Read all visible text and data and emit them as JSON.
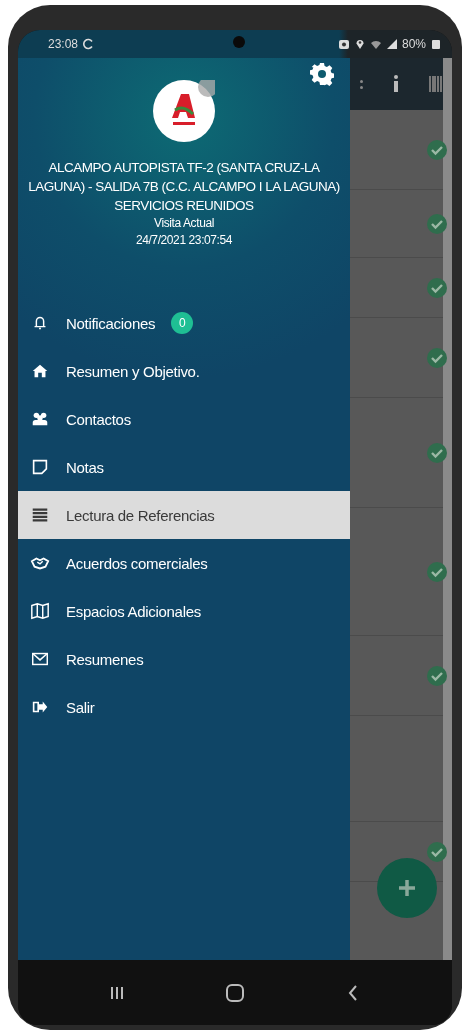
{
  "status_bar": {
    "time": "23:08",
    "battery": "80%"
  },
  "drawer": {
    "header": {
      "store_name": "ALCAMPO AUTOPISTA TF-2 (SANTA CRUZ-LA LAGUNA) - SALIDA 7B (C.C. ALCAMPO I LA LAGUNA)",
      "group": "SERVICIOS REUNIDOS",
      "visit_label": "Visita Actual",
      "visit_time": "24/7/2021 23:07:54"
    },
    "items": [
      {
        "kind": "bell",
        "label": "Notificaciones",
        "badge": "0",
        "selected": false
      },
      {
        "kind": "home",
        "label": "Resumen y Objetivo.",
        "selected": false
      },
      {
        "kind": "people",
        "label": "Contactos",
        "selected": false
      },
      {
        "kind": "note",
        "label": "Notas",
        "selected": false
      },
      {
        "kind": "list",
        "label": "Lectura de Referencias",
        "selected": true
      },
      {
        "kind": "handshake",
        "label": "Acuerdos comerciales",
        "selected": false
      },
      {
        "kind": "map",
        "label": "Espacios Adicionales",
        "selected": false
      },
      {
        "kind": "mail",
        "label": "Resumenes",
        "selected": false
      },
      {
        "kind": "exit",
        "label": "Salir",
        "selected": false
      }
    ]
  }
}
